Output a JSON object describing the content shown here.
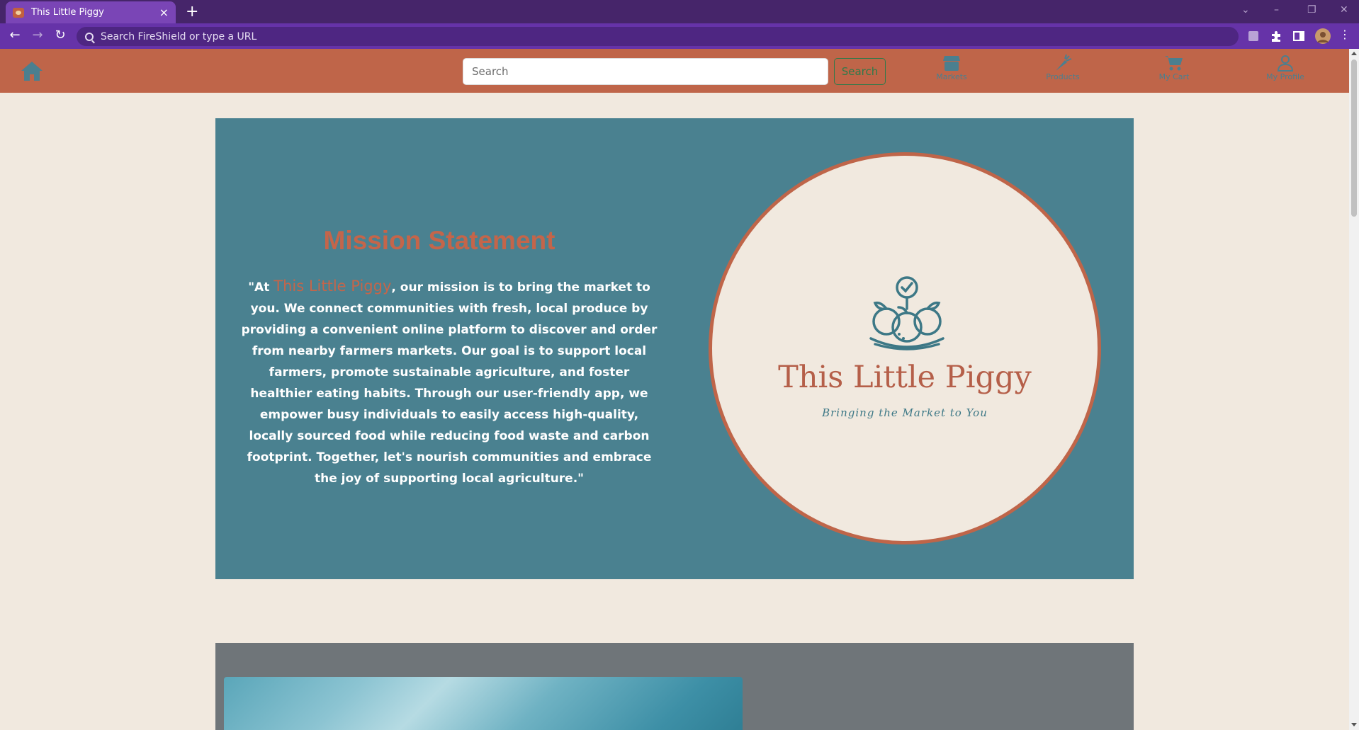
{
  "browser": {
    "tab_title": "This Little Piggy",
    "tab_close": "×",
    "new_tab": "+",
    "address_placeholder": "Search FireShield or type a URL",
    "back": "←",
    "forward": "→",
    "reload": "↻",
    "minimize": "–",
    "restore": "❐",
    "close": "✕",
    "tab_list": "⌄",
    "menu": "⋮"
  },
  "header": {
    "search_placeholder": "Search",
    "search_button": "Search",
    "nav": [
      {
        "label": "Markets",
        "icon": "store-icon"
      },
      {
        "label": "Products",
        "icon": "carrot-icon"
      },
      {
        "label": "My Cart",
        "icon": "cart-icon"
      },
      {
        "label": "My Profile",
        "icon": "user-icon"
      }
    ]
  },
  "mission": {
    "title": "Mission Statement",
    "quote_open": "\"At ",
    "brand": "This Little Piggy",
    "body": ", our mission is to bring the market to you. We connect communities with fresh, local produce by providing a convenient online platform to discover and order from nearby farmers markets. Our goal is to support local farmers, promote sustainable agriculture, and foster healthier eating habits. Through our user-friendly app, we empower busy individuals to easily access high-quality, locally sourced food while reducing food waste and carbon footprint. Together, let's nourish communities and embrace the joy of supporting local agriculture.\""
  },
  "logo": {
    "name": "This Little Piggy",
    "tagline": "Bringing the Market to You"
  },
  "colors": {
    "header": "#bf6549",
    "mission_bg": "#4a8190",
    "accent": "#c4654a",
    "page_bg": "#f1e9df",
    "browser_purple": "#6633a8"
  }
}
